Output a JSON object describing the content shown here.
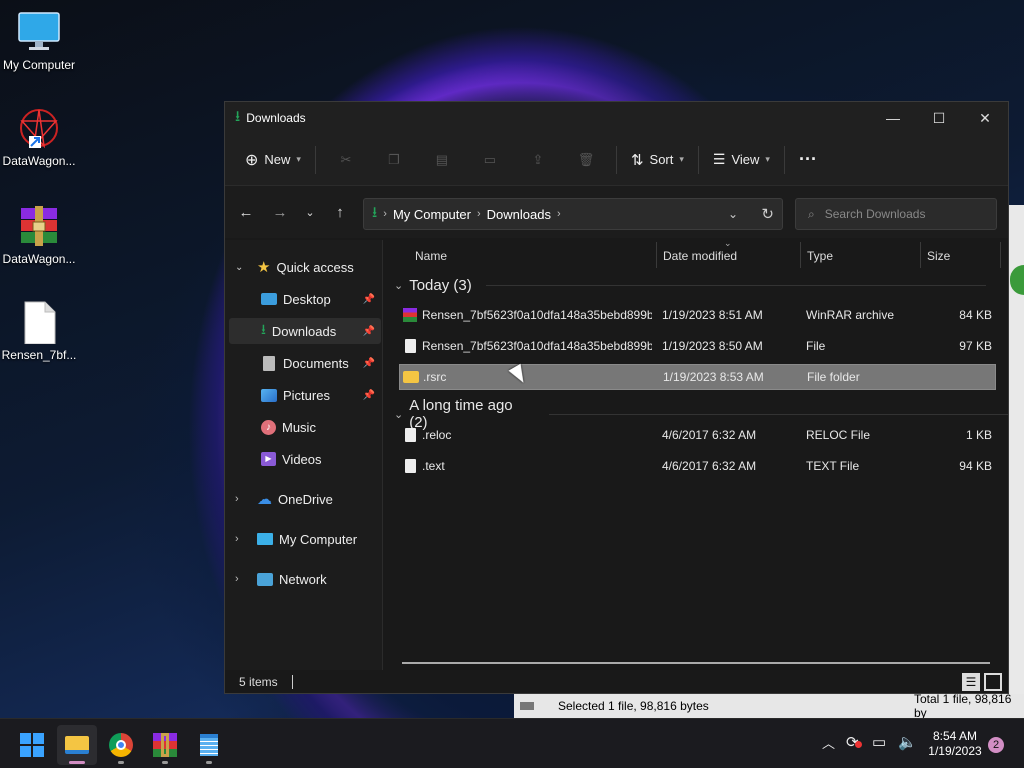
{
  "desktop": {
    "icons": [
      {
        "label": "My Computer"
      },
      {
        "label": "DataWagon..."
      },
      {
        "label": "DataWagon..."
      },
      {
        "label": "Rensen_7bf..."
      }
    ]
  },
  "window": {
    "title": "Downloads",
    "toolbar": {
      "new_label": "New",
      "sort_label": "Sort",
      "view_label": "View",
      "more": "···"
    },
    "address": {
      "crumbs": [
        "My Computer",
        "Downloads"
      ]
    },
    "search": {
      "placeholder": "Search Downloads"
    },
    "sidebar": {
      "quick_access": "Quick access",
      "items": [
        {
          "label": "Desktop"
        },
        {
          "label": "Downloads"
        },
        {
          "label": "Documents"
        },
        {
          "label": "Pictures"
        },
        {
          "label": "Music"
        },
        {
          "label": "Videos"
        }
      ],
      "roots": [
        {
          "label": "OneDrive"
        },
        {
          "label": "My Computer"
        },
        {
          "label": "Network"
        }
      ]
    },
    "columns": {
      "name": "Name",
      "date": "Date modified",
      "type": "Type",
      "size": "Size"
    },
    "groups": [
      {
        "label": "Today (3)",
        "files": [
          {
            "name": "Rensen_7bf5623f0a10dfa148a35bebd899b...",
            "date": "1/19/2023 8:51 AM",
            "type": "WinRAR archive",
            "size": "84 KB"
          },
          {
            "name": "Rensen_7bf5623f0a10dfa148a35bebd899b...",
            "date": "1/19/2023 8:50 AM",
            "type": "File",
            "size": "97 KB"
          },
          {
            "name": ".rsrc",
            "date": "1/19/2023 8:53 AM",
            "type": "File folder",
            "size": ""
          }
        ]
      },
      {
        "label": "A long time ago (2)",
        "files": [
          {
            "name": ".reloc",
            "date": "4/6/2017 6:32 AM",
            "type": "RELOC File",
            "size": "1 KB"
          },
          {
            "name": ".text",
            "date": "4/6/2017 6:32 AM",
            "type": "TEXT File",
            "size": "94 KB"
          }
        ]
      }
    ],
    "status": {
      "count": "5 items"
    }
  },
  "background_window": {
    "status_selected": "Selected 1 file, 98,816 bytes",
    "status_total": "Total 1 file, 98,816 by"
  },
  "taskbar": {
    "time": "8:54 AM",
    "date": "1/19/2023",
    "notifications": "2"
  },
  "colors": {
    "accent_green": "#23a55a",
    "folder_yellow": "#f4c543",
    "selection": "#777777"
  }
}
